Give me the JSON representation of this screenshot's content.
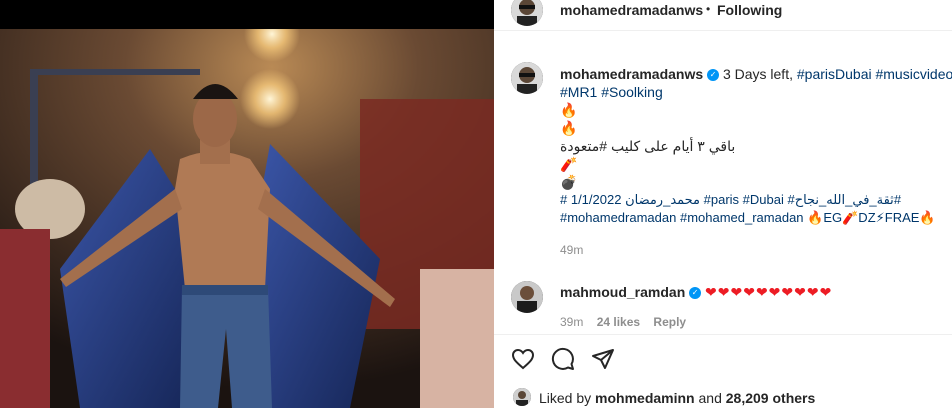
{
  "post": {
    "username": "mohamedramadanws",
    "follow_separator": "•",
    "follow_status": "Following"
  },
  "caption": {
    "username": "mohamedramadanws",
    "line1_text": "3 Days left, ",
    "line1_tags": "#parisDubai #musicvideo",
    "line2_tags": "#MR1 #Soolking",
    "emoji_fire1": "🔥",
    "emoji_fire2": "🔥",
    "arabic_line": "باقي ٣ أيام على كليب #متعودة",
    "emoji_firecracker": "🧨",
    "emoji_bomb": "💣",
    "hashtag_line1": "# 1/1/2022 محمد_رمضان #paris #Dubai #ثقة_في_الله_نجاح#",
    "hashtag_line2": "#mohamedramadan #mohamed_ramadan 🔥EG🧨DZ⚡FRAE🔥",
    "time": "49m"
  },
  "comment": {
    "username": "mahmoud_ramdan",
    "hearts": "❤❤❤❤❤❤❤❤❤❤",
    "time": "39m",
    "likes": "24 likes",
    "reply": "Reply"
  },
  "likes": {
    "prefix": "Liked by",
    "user": "mohmedaminn",
    "middle": "and",
    "others": "28,209 others"
  },
  "icons": [
    "heart-icon",
    "comment-icon",
    "share-icon",
    "verified-icon"
  ],
  "colors": {
    "link": "#00376b",
    "verified": "#0095f6",
    "heart": "#ed1c24"
  }
}
